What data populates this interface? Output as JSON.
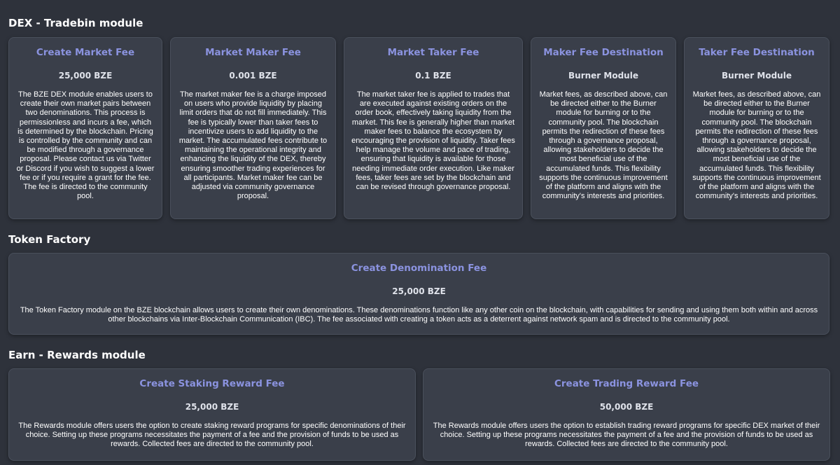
{
  "sections": {
    "dex": {
      "title": "DEX - Tradebin module",
      "cards": [
        {
          "title": "Create Market Fee",
          "value": "25,000 BZE",
          "description": "The BZE DEX module enables users to create their own market pairs between two denominations. This process is permissionless and incurs a fee, which is determined by the blockchain. Pricing is controlled by the community and can be modified through a governance proposal. Please contact us via Twitter or Discord if you wish to suggest a lower fee or if you require a grant for the fee. The fee is directed to the community pool."
        },
        {
          "title": "Market Maker Fee",
          "value": "0.001 BZE",
          "description": "The market maker fee is a charge imposed on users who provide liquidity by placing limit orders that do not fill immediately. This fee is typically lower than taker fees to incentivize users to add liquidity to the market. The accumulated fees contribute to maintaining the operational integrity and enhancing the liquidity of the DEX, thereby ensuring smoother trading experiences for all participants. Market maker fee can be adjusted via community governance proposal."
        },
        {
          "title": "Market Taker Fee",
          "value": "0.1 BZE",
          "description": "The market taker fee is applied to trades that are executed against existing orders on the order book, effectively taking liquidity from the market. This fee is generally higher than market maker fees to balance the ecosystem by encouraging the provision of liquidity. Taker fees help manage the volume and pace of trading, ensuring that liquidity is available for those needing immediate order execution. Like maker fees, taker fees are set by the blockchain and can be revised through governance proposal."
        },
        {
          "title": "Maker Fee Destination",
          "value": "Burner Module",
          "description": "Market fees, as described above, can be directed either to the Burner module for burning or to the community pool. The blockchain permits the redirection of these fees through a governance proposal, allowing stakeholders to decide the most beneficial use of the accumulated funds. This flexibility supports the continuous improvement of the platform and aligns with the community's interests and priorities."
        },
        {
          "title": "Taker Fee Destination",
          "value": "Burner Module",
          "description": "Market fees, as described above, can be directed either to the Burner module for burning or to the community pool. The blockchain permits the redirection of these fees through a governance proposal, allowing stakeholders to decide the most beneficial use of the accumulated funds. This flexibility supports the continuous improvement of the platform and aligns with the community's interests and priorities."
        }
      ]
    },
    "token_factory": {
      "title": "Token Factory",
      "cards": [
        {
          "title": "Create Denomination Fee",
          "value": "25,000 BZE",
          "description": "The Token Factory module on the BZE blockchain allows users to create their own denominations. These denominations function like any other coin on the blockchain, with capabilities for sending and using them both within and across other blockchains via Inter-Blockchain Communication (IBC). The fee associated with creating a token acts as a deterrent against network spam and is directed to the community pool."
        }
      ]
    },
    "earn": {
      "title": "Earn - Rewards module",
      "cards": [
        {
          "title": "Create Staking Reward Fee",
          "value": "25,000 BZE",
          "description": "The Rewards module offers users the option to create staking reward programs for specific denominations of their choice. Setting up these programs necessitates the payment of a fee and the provision of funds to be used as rewards. Collected fees are directed to the community pool."
        },
        {
          "title": "Create Trading Reward Fee",
          "value": "50,000 BZE",
          "description": "The Rewards module offers users the option to establish trading reward programs for specific DEX market of their choice. Setting up these programs necessitates the payment of a fee and the provision of funds to be used as rewards. Collected fees are directed to the community pool."
        }
      ]
    }
  },
  "colors": {
    "background": "#2e323b",
    "card": "#3a3f4a",
    "accent": "#8b93e0"
  }
}
